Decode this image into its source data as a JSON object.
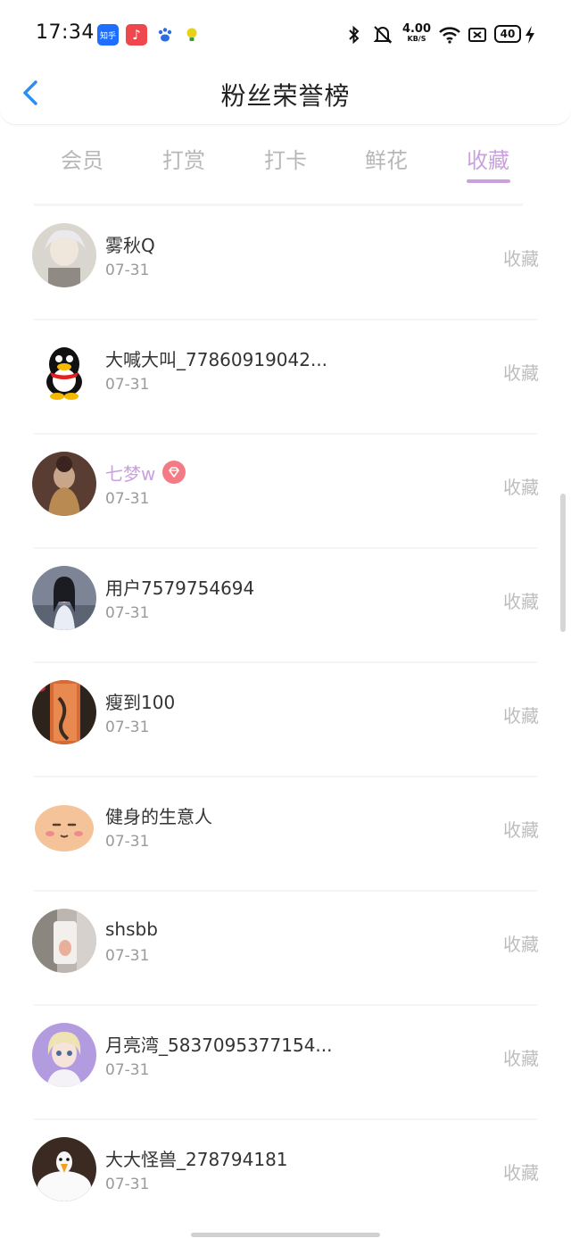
{
  "status_bar": {
    "time": "17:34",
    "app_icons": [
      "zhihu-icon",
      "music-icon",
      "baidu-icon",
      "bulb-icon"
    ],
    "apps": {
      "zhihu_label": "知乎",
      "music_glyph": "♪"
    },
    "net_speed_value": "4.00",
    "net_speed_unit": "KB/S",
    "battery": "40",
    "system_icons": [
      "bluetooth-icon",
      "mute-bell-icon",
      "wifi-icon",
      "screen-icon",
      "battery-icon",
      "charging-icon"
    ]
  },
  "header": {
    "title": "粉丝荣誉榜",
    "back_icon": "chevron-left-icon"
  },
  "tabs": [
    {
      "label": "会员",
      "active": false
    },
    {
      "label": "打赏",
      "active": false
    },
    {
      "label": "打卡",
      "active": false
    },
    {
      "label": "鲜花",
      "active": false
    },
    {
      "label": "收藏",
      "active": true
    }
  ],
  "colors": {
    "accent": "#c9a2dd",
    "inactive_tab": "#b7b7b7",
    "action_text": "#bdbdbd",
    "vip_badge": "#f47b86"
  },
  "rows": [
    {
      "name": "雾秋Q",
      "date": "07-31",
      "action": "收藏",
      "vip": false
    },
    {
      "name": "大喊大叫_77860919042...",
      "date": "07-31",
      "action": "收藏",
      "vip": false
    },
    {
      "name": "七梦w",
      "date": "07-31",
      "action": "收藏",
      "vip": true
    },
    {
      "name": "用户7579754694",
      "date": "07-31",
      "action": "收藏",
      "vip": false
    },
    {
      "name": "瘦到100",
      "date": "07-31",
      "action": "收藏",
      "vip": false
    },
    {
      "name": "健身的生意人",
      "date": "07-31",
      "action": "收藏",
      "vip": false
    },
    {
      "name": "shsbb",
      "date": "07-31",
      "action": "收藏",
      "vip": false
    },
    {
      "name": "月亮湾_5837095377154...",
      "date": "07-31",
      "action": "收藏",
      "vip": false
    },
    {
      "name": "大大怪兽_278794181",
      "date": "07-31",
      "action": "收藏",
      "vip": false
    }
  ]
}
